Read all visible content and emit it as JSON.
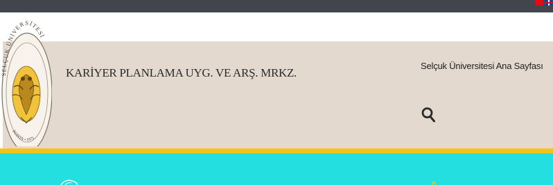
{
  "topbar": {
    "language_flags": [
      {
        "icon": "turkey-flag-icon",
        "color": "#e30a17"
      },
      {
        "icon": "uk-flag-icon",
        "color": "#1f3f8f"
      }
    ]
  },
  "logo": {
    "icon": "selcuk-university-seal-icon",
    "seal_text_top": "SELÇUK ÜNİVERSİTESİ",
    "seal_text_bottom": "KONYA • 1975"
  },
  "header": {
    "site_title": "KARİYER PLANLAMA UYG. VE ARŞ. MRKZ.",
    "home_link": "Selçuk Üniversitesi Ana Sayfası",
    "search_icon": "search-icon"
  },
  "colors": {
    "topbar": "#42454c",
    "header_bg": "#e3d9cf",
    "gold_line": "#f2c41c",
    "banner": "#24dfdf"
  }
}
